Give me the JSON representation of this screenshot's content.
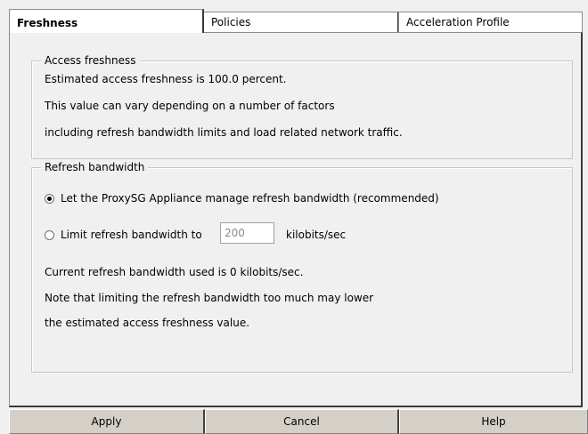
{
  "tabs": [
    {
      "label": "Freshness",
      "active": true
    },
    {
      "label": "Policies",
      "active": false
    },
    {
      "label": "Acceleration Profile",
      "active": false
    }
  ],
  "access_freshness": {
    "legend": "Access freshness",
    "lines": [
      "Estimated access freshness is 100.0 percent.",
      "This value can vary depending on a number of factors",
      "including refresh bandwidth limits and load related network traffic."
    ]
  },
  "refresh_bandwidth": {
    "legend": "Refresh bandwidth",
    "option_manage": {
      "label": "Let the ProxySG Appliance manage refresh bandwidth (recommended)",
      "checked": true
    },
    "option_limit": {
      "label": "Limit refresh bandwidth to",
      "checked": false
    },
    "limit_value": "200",
    "unit": "kilobits/sec",
    "notes": [
      "Current refresh bandwidth used is 0 kilobits/sec.",
      "Note that limiting the refresh bandwidth too much may lower",
      "the estimated access freshness value."
    ]
  },
  "buttons": {
    "apply": "Apply",
    "cancel": "Cancel",
    "help": "Help"
  }
}
